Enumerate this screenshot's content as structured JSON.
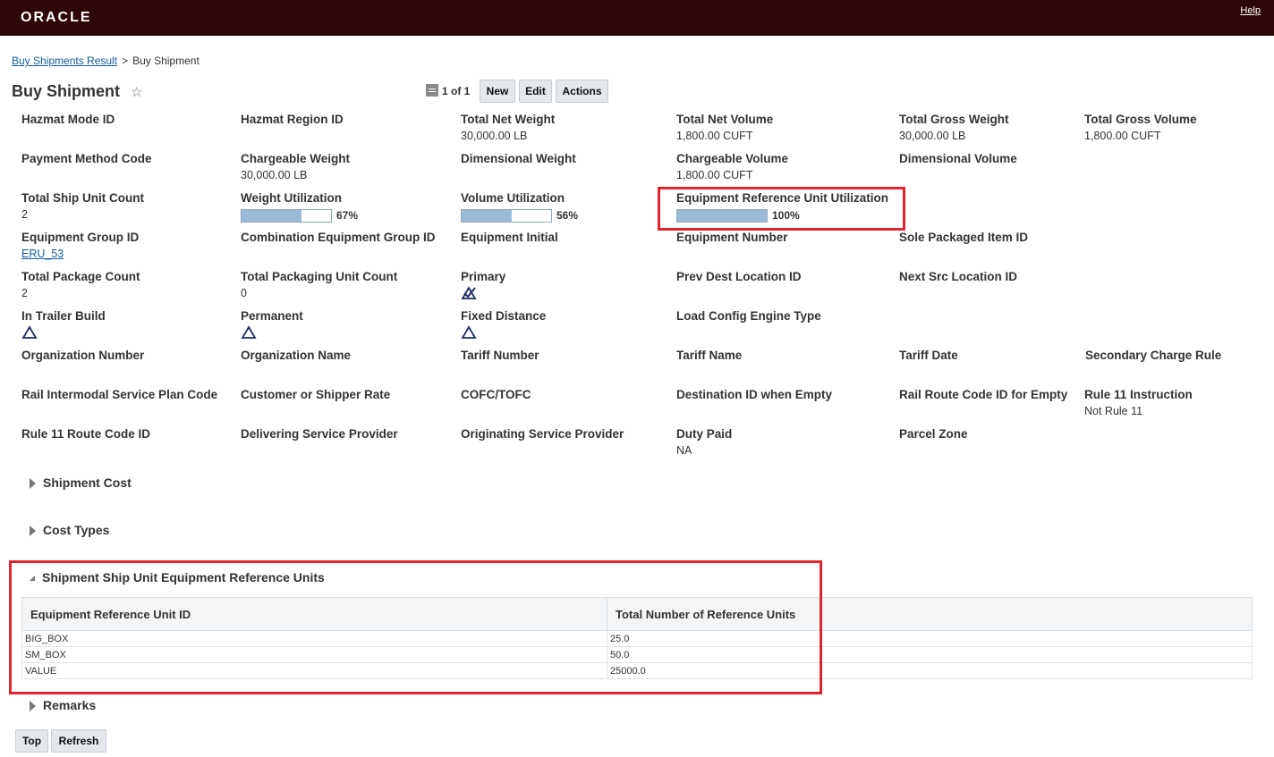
{
  "app": {
    "logo": "ORACLE",
    "help": "Help"
  },
  "breadcrumb": {
    "parent": "Buy Shipments Result",
    "separator": ">",
    "current": "Buy Shipment"
  },
  "page": {
    "title": "Buy Shipment",
    "star": "☆"
  },
  "toolbar": {
    "pager": "1 of 1",
    "new": "New",
    "edit": "Edit",
    "actions": "Actions"
  },
  "fields": {
    "hazmat_mode_id": {
      "label": "Hazmat Mode ID"
    },
    "hazmat_region_id": {
      "label": "Hazmat Region ID"
    },
    "total_net_weight": {
      "label": "Total Net Weight",
      "value": "30,000.00 LB"
    },
    "total_net_volume": {
      "label": "Total Net Volume",
      "value": "1,800.00 CUFT"
    },
    "total_gross_weight": {
      "label": "Total Gross Weight",
      "value": "30,000.00 LB"
    },
    "total_gross_volume": {
      "label": "Total Gross Volume",
      "value": "1,800.00 CUFT"
    },
    "payment_method_code": {
      "label": "Payment Method Code"
    },
    "chargeable_weight": {
      "label": "Chargeable Weight",
      "value": "30,000.00 LB"
    },
    "dimensional_weight": {
      "label": "Dimensional Weight"
    },
    "chargeable_volume": {
      "label": "Chargeable Volume",
      "value": "1,800.00 CUFT"
    },
    "dimensional_volume": {
      "label": "Dimensional Volume"
    },
    "total_ship_unit_count": {
      "label": "Total Ship Unit Count",
      "value": "2"
    },
    "weight_utilization": {
      "label": "Weight Utilization",
      "value": "67%",
      "fraction": 0.67
    },
    "volume_utilization": {
      "label": "Volume Utilization",
      "value": "56%",
      "fraction": 0.56
    },
    "eru_utilization": {
      "label": "Equipment Reference Unit Utilization",
      "value": "100%",
      "fraction": 1.0
    },
    "equipment_group_id": {
      "label": "Equipment Group ID",
      "value": "ERU_53"
    },
    "combination_equipment_group_id": {
      "label": "Combination Equipment Group ID"
    },
    "equipment_initial": {
      "label": "Equipment Initial"
    },
    "equipment_number": {
      "label": "Equipment Number"
    },
    "sole_packaged_item_id": {
      "label": "Sole Packaged Item ID"
    },
    "total_package_count": {
      "label": "Total Package Count",
      "value": "2"
    },
    "total_packaging_unit_count": {
      "label": "Total Packaging Unit Count",
      "value": "0"
    },
    "primary": {
      "label": "Primary",
      "icon": "checked-triangle-icon"
    },
    "prev_dest_location_id": {
      "label": "Prev Dest Location ID"
    },
    "next_src_location_id": {
      "label": "Next Src Location ID"
    },
    "in_trailer_build": {
      "label": "In Trailer Build",
      "icon": "unchecked-triangle-icon"
    },
    "permanent": {
      "label": "Permanent",
      "icon": "unchecked-triangle-icon"
    },
    "fixed_distance": {
      "label": "Fixed Distance",
      "icon": "unchecked-triangle-icon"
    },
    "load_config_engine_type": {
      "label": "Load Config Engine Type"
    },
    "organization_number": {
      "label": "Organization Number"
    },
    "organization_name": {
      "label": "Organization Name"
    },
    "tariff_number": {
      "label": "Tariff Number"
    },
    "tariff_name": {
      "label": "Tariff Name"
    },
    "tariff_date": {
      "label": "Tariff Date"
    },
    "secondary_charge_rule": {
      "label": "Secondary Charge Rule"
    },
    "rail_intermodal_service_plan_code": {
      "label": "Rail Intermodal Service Plan Code"
    },
    "customer_or_shipper_rate": {
      "label": "Customer or Shipper Rate"
    },
    "cofc_tofc": {
      "label": "COFC/TOFC"
    },
    "destination_id_when_empty": {
      "label": "Destination ID when Empty"
    },
    "rail_route_code_id_for_empty": {
      "label": "Rail Route Code ID for Empty"
    },
    "rule_11_instruction": {
      "label": "Rule 11 Instruction",
      "value": "Not Rule 11"
    },
    "rule_11_route_code_id": {
      "label": "Rule 11 Route Code ID"
    },
    "delivering_service_provider": {
      "label": "Delivering Service Provider"
    },
    "originating_service_provider": {
      "label": "Originating Service Provider"
    },
    "duty_paid": {
      "label": "Duty Paid",
      "value": "NA"
    },
    "parcel_zone": {
      "label": "Parcel Zone"
    }
  },
  "sections": {
    "shipment_cost": "Shipment Cost",
    "cost_types": "Cost Types",
    "eru": "Shipment Ship Unit Equipment Reference Units",
    "remarks": "Remarks"
  },
  "eru_table": {
    "headers": [
      "Equipment Reference Unit ID",
      "Total Number of Reference Units"
    ],
    "rows": [
      [
        "BIG_BOX",
        "25.0"
      ],
      [
        "SM_BOX",
        "50.0"
      ],
      [
        "VALUE",
        "25000.0"
      ]
    ]
  },
  "footer": {
    "top": "Top",
    "refresh": "Refresh"
  },
  "colors": {
    "header_bg": "#2e0606",
    "highlight_border": "#e0242d",
    "bar_fill": "#9cb9d8",
    "link": "#145c9e"
  }
}
